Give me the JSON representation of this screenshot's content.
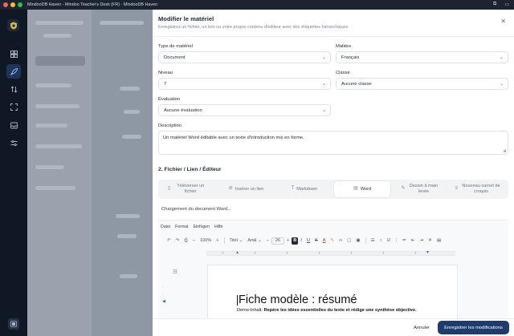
{
  "window": {
    "title": "MindooDB Haven - Mindoo Teacher's Desk (FR) - MindooDB Haven",
    "right_icons": [
      "open-external-icon",
      "sidebar-toggle-icon"
    ]
  },
  "rail": {
    "icons": [
      "logo-icon",
      "dashboard-icon",
      "rocket-icon",
      "transfer-icon",
      "scan-icon",
      "inbox-icon",
      "settings-sliders-icon",
      "user-panel-icon"
    ],
    "active_color": "#1f3556"
  },
  "modal": {
    "title": "Modifier le matériel",
    "subtitle": "Enregistrez un fichier, un lien ou votre propre contenu d'éditeur avec des étiquettes hiérarchiques",
    "close_icon": "close-icon",
    "fields": {
      "type_label": "Type de matériel",
      "type_value": "Document",
      "subject_label": "Matière",
      "subject_value": "Français",
      "level_label": "Niveau",
      "level_value": "7",
      "class_label": "Classe",
      "class_value": "Aucune classe",
      "evaluation_label": "Évaluation",
      "evaluation_value": "Aucune évaluation",
      "description_label": "Description",
      "description_value": "Un matériel Word éditable avec un texte d'introduction mis en forme."
    },
    "section_title": "2. Fichier / Lien / Éditeur",
    "tabs": [
      {
        "label": "Téléverser un fichier",
        "icon": "file-upload-icon",
        "active": false
      },
      {
        "label": "Insérer un lien",
        "icon": "link-icon",
        "active": false
      },
      {
        "label": "Markdown",
        "icon": "markdown-icon",
        "active": false
      },
      {
        "label": "Word",
        "icon": "document-icon",
        "active": true
      },
      {
        "label": "Dessin à main levée",
        "icon": "pencil-icon",
        "active": false
      },
      {
        "label": "Nouveau carnet de croquis",
        "icon": "sketchbook-icon",
        "active": false
      }
    ],
    "editor": {
      "loading_text": "Chargement du document Word...",
      "menu": [
        "Datei",
        "Format",
        "Einfügen",
        "Hilfe"
      ],
      "zoom": "100%",
      "style": "Titel",
      "font": "Arial",
      "font_size": "26",
      "doc_title": "Fiche modèle : résumé",
      "doc_line_prefix": "Demo-Inhalt: ",
      "doc_line_bold": "Repère les idées essentielles du texte et rédige une synthèse objective."
    },
    "footer": {
      "cancel_label": "Annuler",
      "save_label": "Enregistrer les modifications",
      "save_color": "#1e3a6e"
    }
  }
}
